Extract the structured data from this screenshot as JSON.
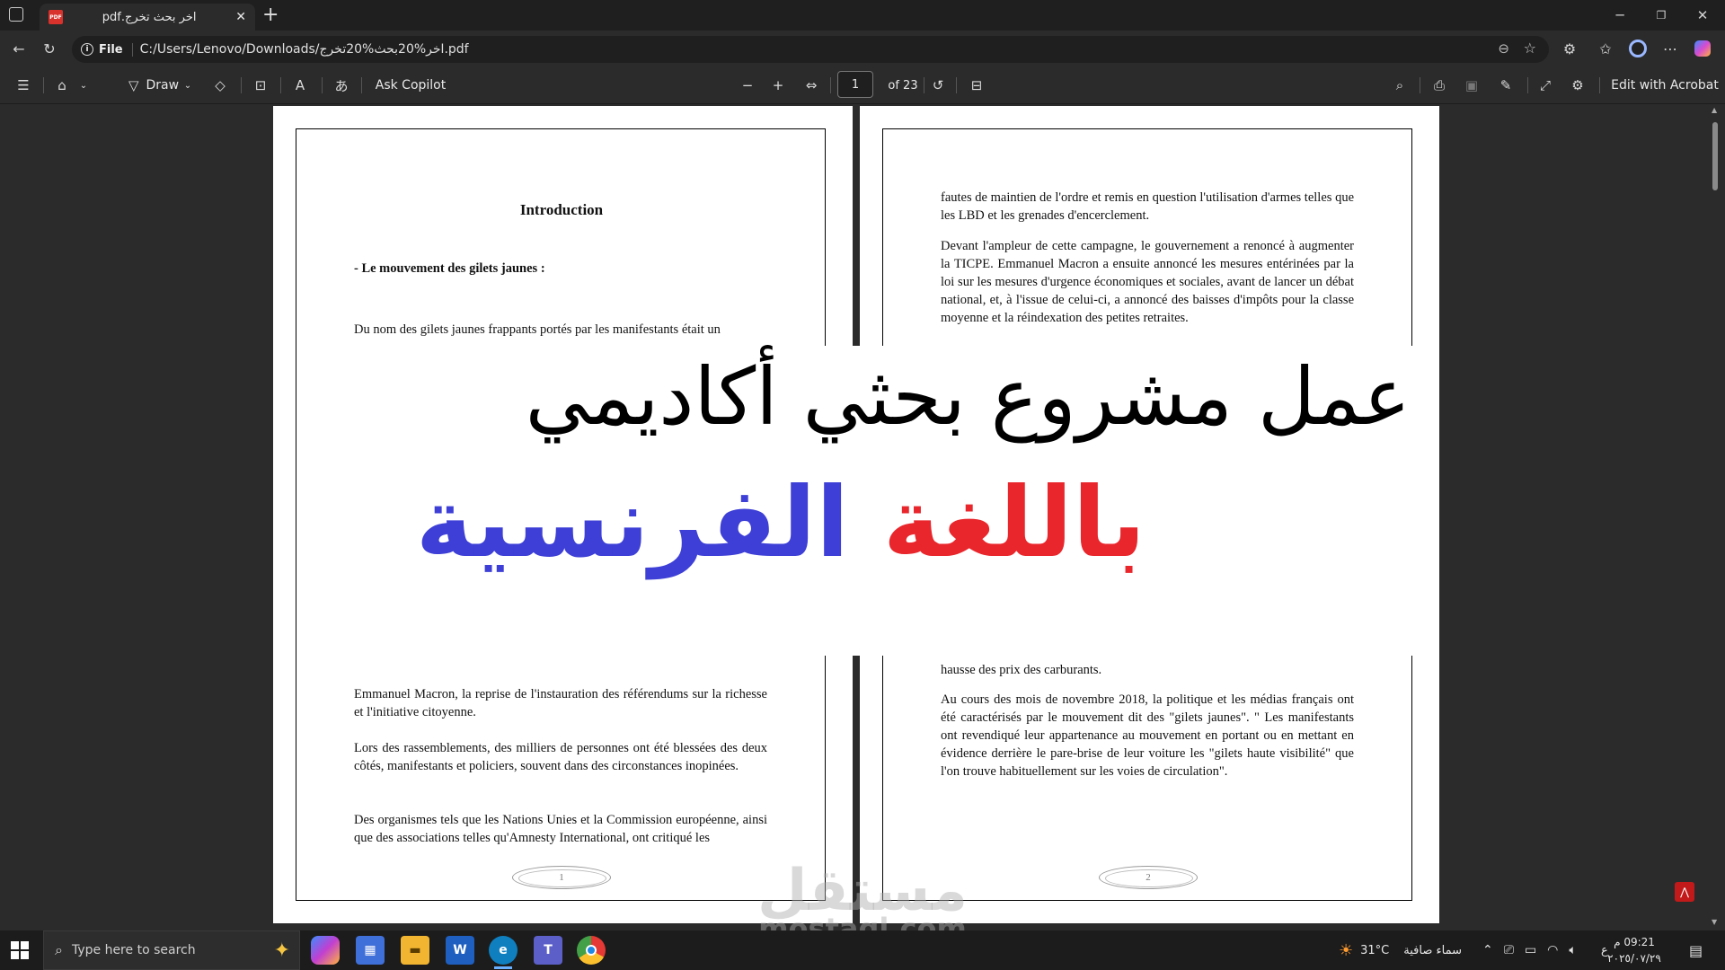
{
  "browser": {
    "tab_title": "اخر بحث تخرج.pdf",
    "new_tab": "+",
    "file_label": "File",
    "url": "C:/Users/Lenovo/Downloads/اخر%20بحث%20تخرج.pdf"
  },
  "toolbar": {
    "draw_label": "Draw",
    "ask_copilot": "Ask Copilot",
    "page_current": "1",
    "page_total": "of 23",
    "edit_acrobat": "Edit with Acrobat"
  },
  "page1": {
    "title": "Introduction",
    "bullet": "-    Le mouvement des gilets jaunes :",
    "para_top": "Du nom des gilets jaunes frappants portés par les manifestants  était un",
    "para_bottom1": "Emmanuel Macron, la reprise de l'instauration des référendums sur la richesse et l'initiative citoyenne.",
    "para_bottom2": "Lors des rassemblements, des milliers de personnes ont été blessées des deux côtés, manifestants et policiers, souvent dans des circonstances inopinées.",
    "para_bottom3": "Des organismes tels que les Nations Unies et la Commission européenne, ainsi que des associations telles qu'Amnesty International, ont critiqué les",
    "page_number": "1"
  },
  "page2": {
    "para1": "fautes de maintien de l'ordre et remis en question l'utilisation d'armes telles que les LBD et les grenades d'encerclement.",
    "para2": "Devant l'ampleur de cette campagne, le gouvernement a renoncé à augmenter la TICPE. Emmanuel Macron a ensuite annoncé les mesures entérinées par la loi sur les mesures d'urgence économiques et sociales, avant de lancer un débat national, et, à l'issue de celui-ci, a annoncé des baisses d'impôts pour la classe moyenne et la réindexation des petites retraites.",
    "para3": "hausse des prix des carburants.",
    "para4": "Au cours des mois de novembre 2018, la politique et les médias français ont été caractérisés par le mouvement dit des \"gilets jaunes\". \" Les manifestants ont revendiqué leur appartenance au mouvement en portant ou en mettant en évidence derrière le pare-brise de leur voiture les \"gilets haute  visibilité\" que l'on trouve habituellement sur les voies de circulation\".",
    "page_number": "2"
  },
  "banner": {
    "line1": "عمل مشروع بحثي أكاديمي",
    "line2_red": "باللغة",
    "line2_blue": "الفرنسية",
    "colors": {
      "red": "#e8262c",
      "blue": "#3d3fd6"
    }
  },
  "watermark": {
    "logo": "مستقل",
    "domain": "mostaql.com"
  },
  "taskbar": {
    "search_placeholder": "Type here to search",
    "weather_temp": "31°C",
    "weather_text": "سماء صافية",
    "lang": "ع",
    "time": "09:21 م",
    "date": "٢٠٢٥/٠٧/٢٩"
  }
}
